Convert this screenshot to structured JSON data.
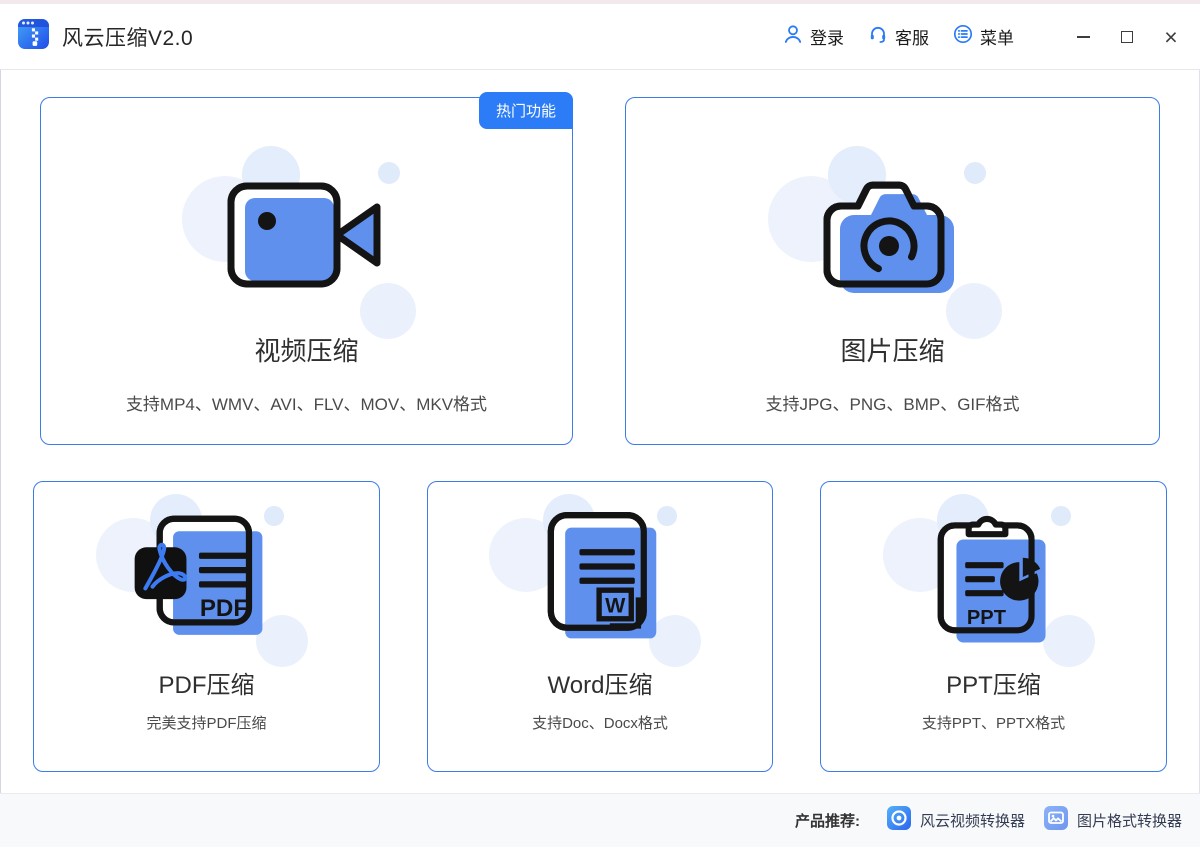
{
  "header": {
    "app_title": "风云压缩V2.0",
    "nav": [
      {
        "label": "登录",
        "icon": "user-icon"
      },
      {
        "label": "客服",
        "icon": "headset-icon"
      },
      {
        "label": "菜单",
        "icon": "menu-icon"
      }
    ]
  },
  "icons": {
    "close_glyph": "×"
  },
  "cards": [
    {
      "title": "视频压缩",
      "subtitle": "支持MP4、WMV、AVI、FLV、MOV、MKV格式",
      "badge": "热门功能",
      "icon": "video-camera-icon"
    },
    {
      "title": "图片压缩",
      "subtitle": "支持JPG、PNG、BMP、GIF格式",
      "icon": "photo-camera-icon"
    },
    {
      "title": "PDF压缩",
      "subtitle": "完美支持PDF压缩",
      "icon": "pdf-document-icon",
      "icon_label": "PDF"
    },
    {
      "title": "Word压缩",
      "subtitle": "支持Doc、Docx格式",
      "icon": "word-document-icon",
      "icon_label": "W"
    },
    {
      "title": "PPT压缩",
      "subtitle": "支持PPT、PPTX格式",
      "icon": "ppt-clipboard-icon",
      "icon_label": "PPT"
    }
  ],
  "footer": {
    "label": "产品推荐:",
    "products": [
      {
        "name": "风云视频转换器",
        "icon": "video-converter-icon"
      },
      {
        "name": "图片格式转换器",
        "icon": "image-converter-icon"
      }
    ]
  },
  "colors": {
    "accent": "#2b7cf6",
    "card_border": "#3b7de8",
    "icon_blue": "#5f90ee",
    "badge_bg": "#2b7cf6"
  }
}
